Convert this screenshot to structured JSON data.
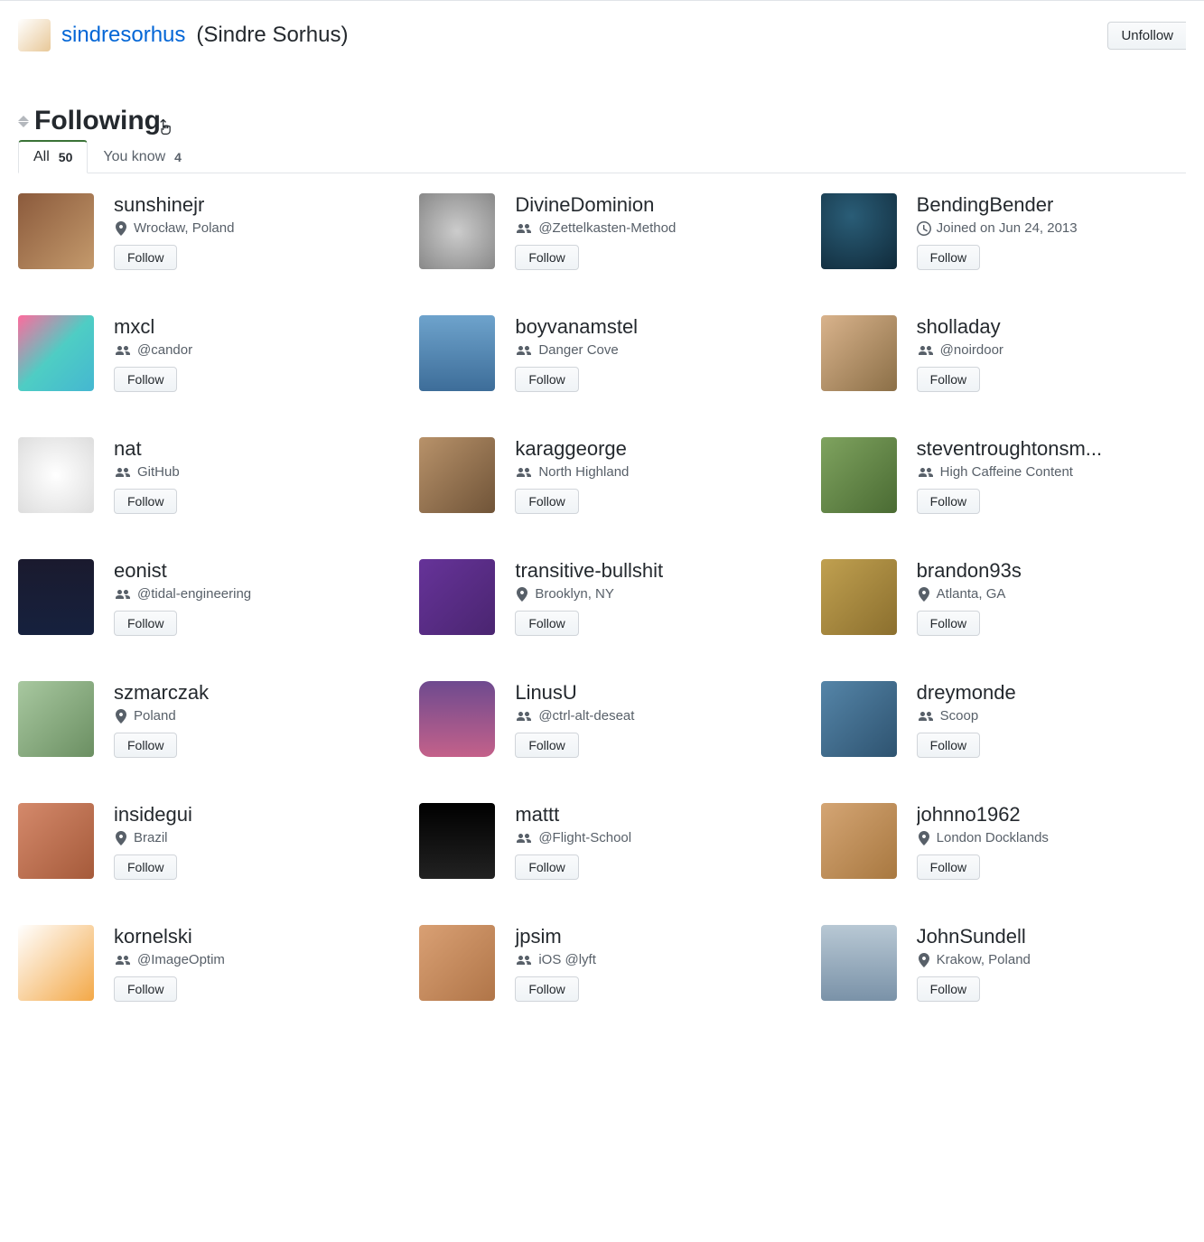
{
  "header": {
    "username": "sindresorhus",
    "realname": "(Sindre Sorhus)",
    "unfollow_label": "Unfollow"
  },
  "section": {
    "title": "Following"
  },
  "tabs": {
    "all_label": "All",
    "all_count": "50",
    "youknow_label": "You know",
    "youknow_count": "4"
  },
  "follow_label": "Follow",
  "users": [
    {
      "login": "sunshinejr",
      "meta_type": "location",
      "meta": "Wrocław, Poland"
    },
    {
      "login": "DivineDominion",
      "meta_type": "org",
      "meta": "@Zettelkasten-Method"
    },
    {
      "login": "BendingBender",
      "meta_type": "clock",
      "meta": "Joined on Jun 24, 2013"
    },
    {
      "login": "mxcl",
      "meta_type": "org",
      "meta": "@candor"
    },
    {
      "login": "boyvanamstel",
      "meta_type": "org",
      "meta": "Danger Cove"
    },
    {
      "login": "sholladay",
      "meta_type": "org",
      "meta": "@noirdoor"
    },
    {
      "login": "nat",
      "meta_type": "org",
      "meta": "GitHub"
    },
    {
      "login": "karaggeorge",
      "meta_type": "org",
      "meta": "North Highland"
    },
    {
      "login": "steventroughtonsm...",
      "meta_type": "org",
      "meta": "High Caffeine Content"
    },
    {
      "login": "eonist",
      "meta_type": "org",
      "meta": "@tidal-engineering"
    },
    {
      "login": "transitive-bullshit",
      "meta_type": "location",
      "meta": "Brooklyn, NY"
    },
    {
      "login": "brandon93s",
      "meta_type": "location",
      "meta": "Atlanta, GA"
    },
    {
      "login": "szmarczak",
      "meta_type": "location",
      "meta": "Poland"
    },
    {
      "login": "LinusU",
      "meta_type": "org",
      "meta": "@ctrl-alt-deseat"
    },
    {
      "login": "dreymonde",
      "meta_type": "org",
      "meta": "Scoop"
    },
    {
      "login": "insidegui",
      "meta_type": "location",
      "meta": "Brazil"
    },
    {
      "login": "mattt",
      "meta_type": "org",
      "meta": "@Flight-School"
    },
    {
      "login": "johnno1962",
      "meta_type": "location",
      "meta": "London Docklands"
    },
    {
      "login": "kornelski",
      "meta_type": "org",
      "meta": "@ImageOptim"
    },
    {
      "login": "jpsim",
      "meta_type": "org",
      "meta": "iOS @lyft"
    },
    {
      "login": "JohnSundell",
      "meta_type": "location",
      "meta": "Krakow, Poland"
    }
  ]
}
